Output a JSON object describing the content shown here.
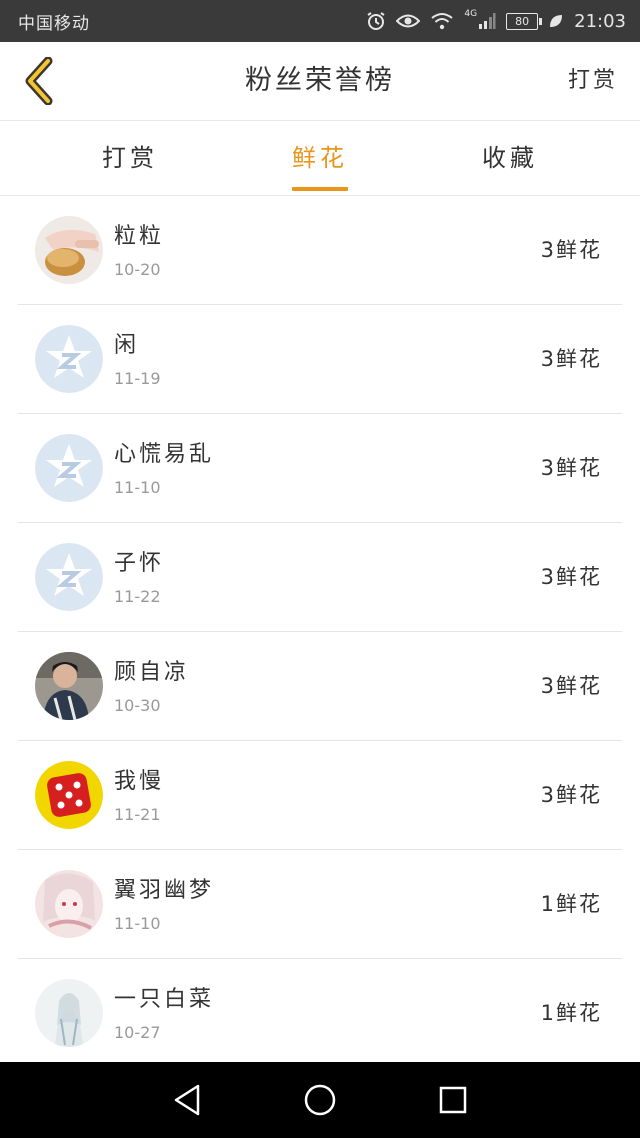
{
  "status_bar": {
    "carrier": "中国移动",
    "network": "4G",
    "battery": "80",
    "time": "21:03"
  },
  "header": {
    "back_icon": "chevron-left-icon",
    "title": "粉丝荣誉榜",
    "action_label": "打赏"
  },
  "tabs": [
    {
      "label": "打赏",
      "active": false
    },
    {
      "label": "鲜花",
      "active": true
    },
    {
      "label": "收藏",
      "active": false
    }
  ],
  "accent_color": "#e9951c",
  "fans": [
    {
      "name": "粒粒",
      "date": "10-20",
      "count": "3鲜花",
      "avatar": "photo-hand-egg"
    },
    {
      "name": "闲",
      "date": "11-19",
      "count": "3鲜花",
      "avatar": "default-qq-star"
    },
    {
      "name": "心慌易乱",
      "date": "11-10",
      "count": "3鲜花",
      "avatar": "default-qq-star"
    },
    {
      "name": "子怀",
      "date": "11-22",
      "count": "3鲜花",
      "avatar": "default-qq-star"
    },
    {
      "name": "顾自凉",
      "date": "10-30",
      "count": "3鲜花",
      "avatar": "photo-boy"
    },
    {
      "name": "我慢",
      "date": "11-21",
      "count": "3鲜花",
      "avatar": "red-dice"
    },
    {
      "name": "翼羽幽梦",
      "date": "11-10",
      "count": "1鲜花",
      "avatar": "anime-girl"
    },
    {
      "name": "一只白菜",
      "date": "10-27",
      "count": "1鲜花",
      "avatar": "anime-white-figure"
    }
  ],
  "nav_bar": {
    "back": "triangle-back-icon",
    "home": "circle-home-icon",
    "recents": "square-recents-icon"
  }
}
